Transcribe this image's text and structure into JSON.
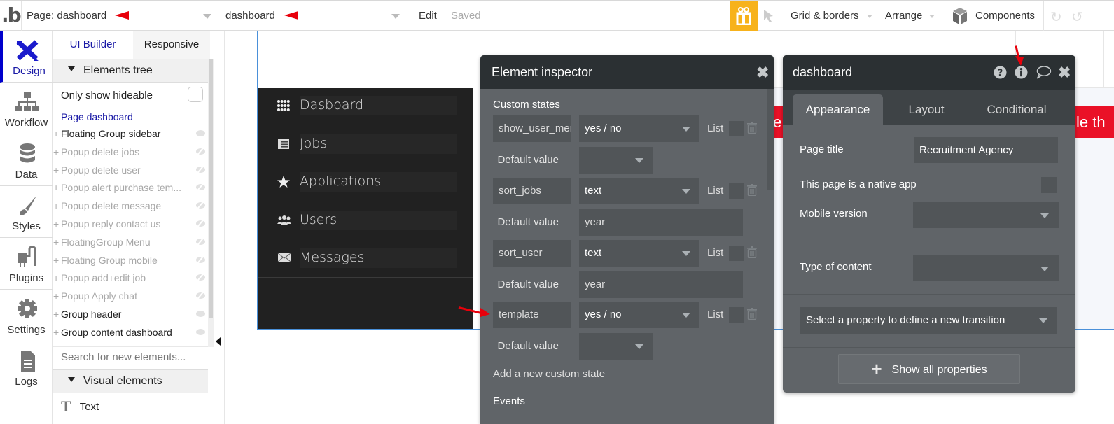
{
  "topbar": {
    "logo": ".b",
    "page_select": "Page: dashboard",
    "element_select": "dashboard",
    "edit": "Edit",
    "saved": "Saved",
    "grid_borders": "Grid & borders",
    "arrange": "Arrange",
    "components": "Components",
    "gift_color": "#f7b21b"
  },
  "rail": {
    "items": [
      {
        "label": "Design",
        "icon": "design-icon",
        "active": true
      },
      {
        "label": "Workflow",
        "icon": "workflow-icon"
      },
      {
        "label": "Data",
        "icon": "database-icon"
      },
      {
        "label": "Styles",
        "icon": "brush-icon"
      },
      {
        "label": "Plugins",
        "icon": "plug-icon"
      },
      {
        "label": "Settings",
        "icon": "gear-icon"
      },
      {
        "label": "Logs",
        "icon": "document-icon"
      }
    ]
  },
  "left_panel": {
    "tabs": [
      "UI Builder",
      "Responsive"
    ],
    "elements_tree": "Elements tree",
    "only_show_hideable": "Only show hideable",
    "page_link": "Page dashboard",
    "tree": [
      {
        "name": "Floating Group sidebar",
        "visible": true
      },
      {
        "name": "Popup delete jobs",
        "visible": false
      },
      {
        "name": "Popup delete user",
        "visible": false
      },
      {
        "name": "Popup alert purchase tem...",
        "visible": false
      },
      {
        "name": "Popup delete message",
        "visible": false
      },
      {
        "name": "Popup reply contact us",
        "visible": false
      },
      {
        "name": "FloatingGroup Menu",
        "visible": false
      },
      {
        "name": "Floating Group mobile",
        "visible": false
      },
      {
        "name": "Popup add+edit job",
        "visible": false
      },
      {
        "name": "Popup Apply chat",
        "visible": false
      },
      {
        "name": "Group header",
        "visible": true
      },
      {
        "name": "Group content dashboard",
        "visible": true
      }
    ],
    "search_placeholder": "Search for new elements...",
    "visual_elements": "Visual elements",
    "text_element": "Text"
  },
  "canvas": {
    "sidebar_menu": [
      {
        "label": "Dasboard",
        "icon": "grid-icon"
      },
      {
        "label": "Jobs",
        "icon": "newspaper-icon"
      },
      {
        "label": "Applications",
        "icon": "star-icon"
      },
      {
        "label": "Users",
        "icon": "users-icon"
      },
      {
        "label": "Messages",
        "icon": "envelope-icon"
      }
    ],
    "banner_left_text": "e",
    "banner_right_text": "le th",
    "banner_color": "#ea1127"
  },
  "inspector": {
    "title": "Element inspector",
    "custom_states_title": "Custom states",
    "states": [
      {
        "name": "show_user_menu",
        "type": "yes / no",
        "list_label": "List",
        "default_label": "Default value",
        "default_value": "",
        "default_is_dropdown": true
      },
      {
        "name": "sort_jobs",
        "type": "text",
        "list_label": "List",
        "default_label": "Default value",
        "default_value": "year",
        "default_is_dropdown": false
      },
      {
        "name": "sort_user",
        "type": "text",
        "list_label": "List",
        "default_label": "Default value",
        "default_value": "year",
        "default_is_dropdown": false
      },
      {
        "name": "template",
        "type": "yes / no",
        "list_label": "List",
        "default_label": "Default value",
        "default_value": "",
        "default_is_dropdown": true
      }
    ],
    "add_state": "Add a new custom state",
    "events": "Events"
  },
  "property_editor": {
    "title": "dashboard",
    "tabs": [
      "Appearance",
      "Layout",
      "Conditional"
    ],
    "active_tab": "Appearance",
    "page_title_label": "Page title",
    "page_title_value": "Recruitment Agency",
    "native_app_label": "This page is a native app",
    "mobile_version_label": "Mobile version",
    "mobile_version_value": "",
    "type_of_content_label": "Type of content",
    "type_of_content_value": "",
    "transition_placeholder": "Select a property to define a new transition",
    "show_all": "Show all properties"
  }
}
